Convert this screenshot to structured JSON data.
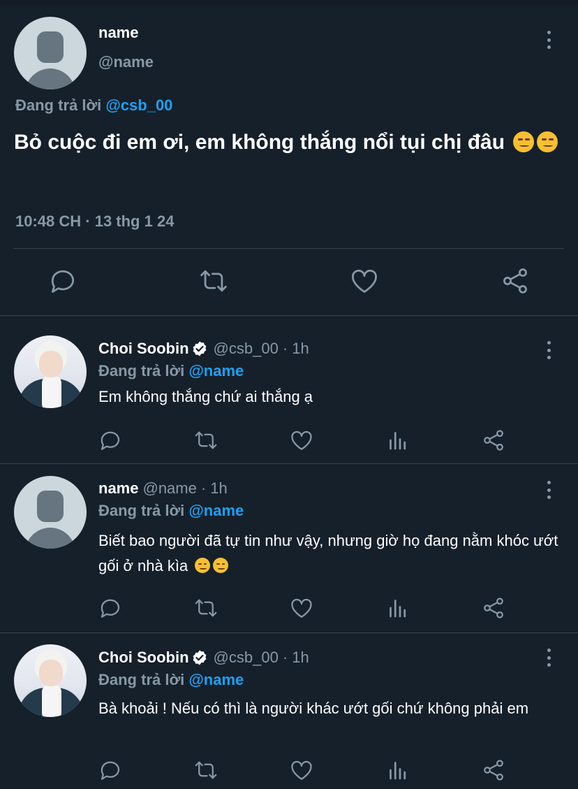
{
  "main_tweet": {
    "name": "name",
    "handle": "@name",
    "replying_prefix": "Đang trả lời",
    "replying_to": "@csb_00",
    "text": "Bỏ cuộc đi em ơi, em không thắng nổi tụi chị đâu",
    "emojis": [
      "smirk-emoji",
      "smirk-emoji"
    ],
    "timestamp": "10:48 CH · 13 thg 1 24"
  },
  "replies": [
    {
      "name": "Choi Soobin",
      "verified": true,
      "handle": "@csb_00",
      "time": "· 1h",
      "replying_prefix": "Đang trả lời",
      "replying_to": "@name",
      "text": "Em không thắng chứ ai thắng ạ"
    },
    {
      "name": "name",
      "verified": false,
      "handle": "@name",
      "time": "· 1h",
      "replying_prefix": "Đang trả lời",
      "replying_to": "@name",
      "text": "Biết bao người đã tự tin như vậy, nhưng giờ họ đang nằm khóc ướt gối ở nhà kìa",
      "emojis": [
        "smirk-emoji",
        "smirk-emoji"
      ]
    },
    {
      "name": "Choi Soobin",
      "verified": true,
      "handle": "@csb_00",
      "time": "· 1h",
      "replying_prefix": "Đang trả lời",
      "replying_to": "@name",
      "text": "Bà khoải ! Nếu có thì là người khác ướt gối chứ không phải em"
    }
  ],
  "colors": {
    "background": "#15202b",
    "divider": "#38444d",
    "secondary_text": "#8899a6",
    "mention": "#1da1f2",
    "verified_badge": "#ffffff"
  },
  "icons": {
    "actions": [
      "reply-icon",
      "retweet-icon",
      "like-icon",
      "analytics-icon",
      "share-icon"
    ]
  }
}
